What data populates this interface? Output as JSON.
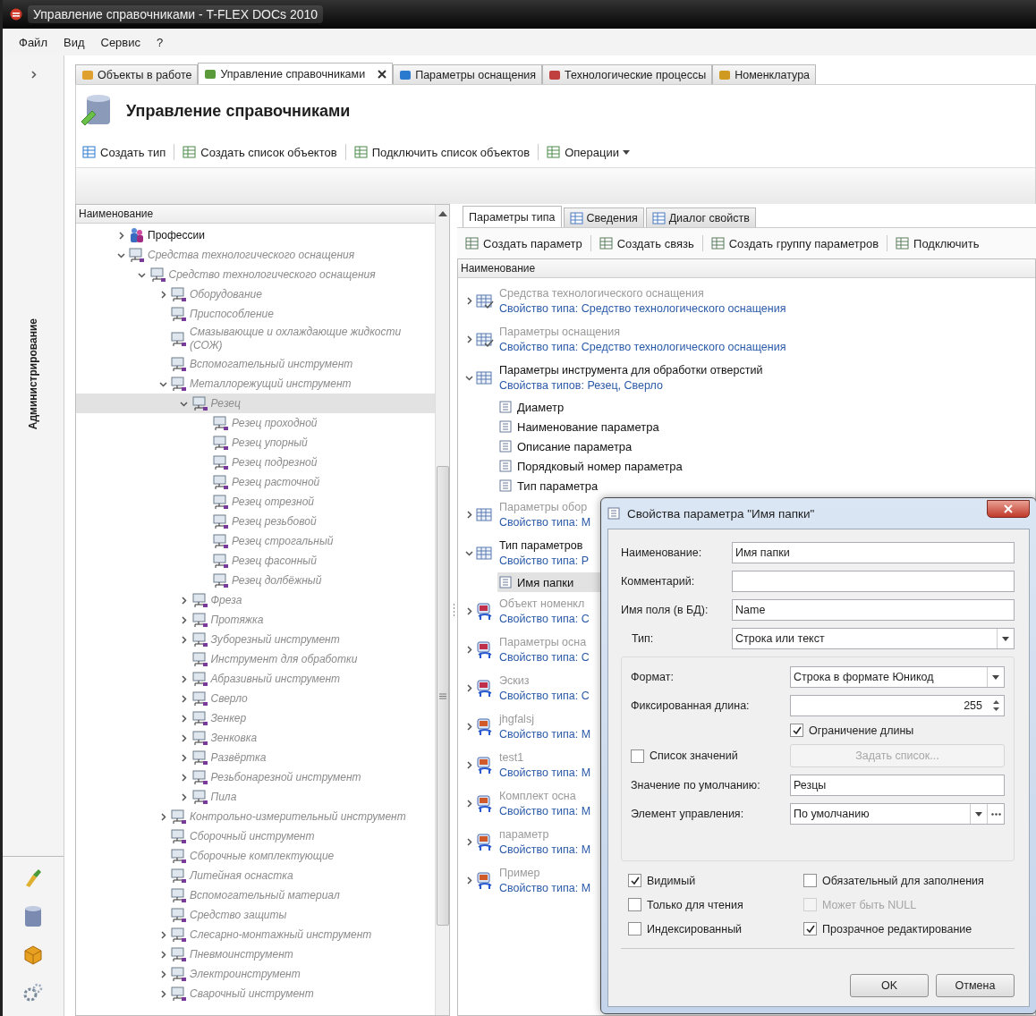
{
  "window": {
    "title": "Управление справочниками - T-FLEX DOCs 2010"
  },
  "menu": [
    "Файл",
    "Вид",
    "Сервис",
    "?"
  ],
  "side_panel": {
    "title": "Администрирование"
  },
  "tabs": [
    {
      "label": "Объекты в работе",
      "selected": false,
      "closable": false
    },
    {
      "label": "Управление справочниками",
      "selected": true,
      "closable": true
    },
    {
      "label": "Параметры оснащения",
      "selected": false,
      "closable": false
    },
    {
      "label": "Технологические процессы",
      "selected": false,
      "closable": false
    },
    {
      "label": "Номенклатура",
      "selected": false,
      "closable": false
    }
  ],
  "page": {
    "title": "Управление справочниками",
    "toolbar": [
      {
        "label": "Создать тип",
        "kind": "button"
      },
      {
        "label": "Создать список объектов",
        "kind": "button"
      },
      {
        "label": "Подключить список объектов",
        "kind": "button"
      },
      {
        "label": "Операции",
        "kind": "menu"
      }
    ]
  },
  "tree": {
    "column": "Наименование",
    "items": [
      {
        "label": "Профессии",
        "kind": "catalog",
        "expanded": false,
        "dimmed": false,
        "selected": false
      },
      {
        "label": "Средства технологического оснащения",
        "kind": "type",
        "expanded": true,
        "dimmed": true,
        "selected": false,
        "children": [
          {
            "label": "Средство технологического оснащения",
            "kind": "type",
            "expanded": true,
            "dimmed": true,
            "selected": false,
            "children": [
              {
                "label": "Оборудование",
                "kind": "type",
                "expanded": false,
                "dimmed": true,
                "selected": false
              },
              {
                "label": "Приспособление",
                "kind": "type",
                "dimmed": true,
                "selected": false
              },
              {
                "label": "Смазывающие и охлаждающие жидкости (СОЖ)",
                "kind": "type",
                "dimmed": true,
                "selected": false
              },
              {
                "label": "Вспомогательный инструмент",
                "kind": "type",
                "dimmed": true,
                "selected": false
              },
              {
                "label": "Металлорежущий инструмент",
                "kind": "type",
                "expanded": true,
                "dimmed": true,
                "selected": false,
                "children": [
                  {
                    "label": "Резец",
                    "kind": "type",
                    "expanded": true,
                    "dimmed": true,
                    "selected": true,
                    "children": [
                      {
                        "label": "Резец проходной",
                        "kind": "type",
                        "dimmed": true,
                        "selected": false
                      },
                      {
                        "label": "Резец упорный",
                        "kind": "type",
                        "dimmed": true,
                        "selected": false
                      },
                      {
                        "label": "Резец подрезной",
                        "kind": "type",
                        "dimmed": true,
                        "selected": false
                      },
                      {
                        "label": "Резец расточной",
                        "kind": "type",
                        "dimmed": true,
                        "selected": false
                      },
                      {
                        "label": "Резец отрезной",
                        "kind": "type",
                        "dimmed": true,
                        "selected": false
                      },
                      {
                        "label": "Резец резьбовой",
                        "kind": "type",
                        "dimmed": true,
                        "selected": false
                      },
                      {
                        "label": "Резец строгальный",
                        "kind": "type",
                        "dimmed": true,
                        "selected": false
                      },
                      {
                        "label": "Резец фасонный",
                        "kind": "type",
                        "dimmed": true,
                        "selected": false
                      },
                      {
                        "label": "Резец долбёжный",
                        "kind": "type",
                        "dimmed": true,
                        "selected": false
                      }
                    ]
                  },
                  {
                    "label": "Фреза",
                    "kind": "type",
                    "expanded": false,
                    "dimmed": true,
                    "selected": false
                  },
                  {
                    "label": "Протяжка",
                    "kind": "type",
                    "expanded": false,
                    "dimmed": true,
                    "selected": false
                  },
                  {
                    "label": "Зуборезный инструмент",
                    "kind": "type",
                    "expanded": false,
                    "dimmed": true,
                    "selected": false
                  },
                  {
                    "label": "Инструмент для обработки",
                    "kind": "type",
                    "dimmed": true,
                    "selected": false
                  },
                  {
                    "label": "Абразивный инструмент",
                    "kind": "type",
                    "expanded": false,
                    "dimmed": true,
                    "selected": false
                  },
                  {
                    "label": "Сверло",
                    "kind": "type",
                    "expanded": false,
                    "dimmed": true,
                    "selected": false
                  },
                  {
                    "label": "Зенкер",
                    "kind": "type",
                    "expanded": false,
                    "dimmed": true,
                    "selected": false
                  },
                  {
                    "label": "Зенковка",
                    "kind": "type",
                    "expanded": false,
                    "dimmed": true,
                    "selected": false
                  },
                  {
                    "label": "Развёртка",
                    "kind": "type",
                    "expanded": false,
                    "dimmed": true,
                    "selected": false
                  },
                  {
                    "label": "Резьбонарезной инструмент",
                    "kind": "type",
                    "expanded": false,
                    "dimmed": true,
                    "selected": false
                  },
                  {
                    "label": "Пила",
                    "kind": "type",
                    "expanded": false,
                    "dimmed": true,
                    "selected": false
                  }
                ]
              },
              {
                "label": "Контрольно-измерительный инструмент",
                "kind": "type",
                "expanded": false,
                "dimmed": true,
                "selected": false
              },
              {
                "label": "Сборочный инструмент",
                "kind": "type",
                "dimmed": true,
                "selected": false
              },
              {
                "label": "Сборочные комплектующие",
                "kind": "type",
                "dimmed": true,
                "selected": false
              },
              {
                "label": "Литейная оснастка",
                "kind": "type",
                "dimmed": true,
                "selected": false
              },
              {
                "label": "Вспомогательный материал",
                "kind": "type",
                "dimmed": true,
                "selected": false
              },
              {
                "label": "Средство защиты",
                "kind": "type",
                "dimmed": true,
                "selected": false
              },
              {
                "label": "Слесарно-монтажный инструмент",
                "kind": "type",
                "expanded": false,
                "dimmed": true,
                "selected": false
              },
              {
                "label": "Пневмоинструмент",
                "kind": "type",
                "expanded": false,
                "dimmed": true,
                "selected": false
              },
              {
                "label": "Электроинструмент",
                "kind": "type",
                "expanded": false,
                "dimmed": true,
                "selected": false
              },
              {
                "label": "Сварочный инструмент",
                "kind": "type",
                "expanded": false,
                "dimmed": true,
                "selected": false
              }
            ]
          }
        ]
      }
    ]
  },
  "right_panel": {
    "tabs": [
      {
        "label": "Параметры типа",
        "selected": true
      },
      {
        "label": "Сведения",
        "selected": false
      },
      {
        "label": "Диалог свойств",
        "selected": false
      }
    ],
    "toolbar": [
      "Создать параметр",
      "Создать связь",
      "Создать группу параметров",
      "Подключить"
    ],
    "column": "Наименование",
    "rows": [
      {
        "kind": "inherited",
        "title": "Средства технологического оснащения",
        "subtitle": "Свойство типа: Средство технологического оснащения",
        "expanded": false,
        "dimmed": true,
        "selected": false
      },
      {
        "kind": "inherited",
        "title": "Параметры оснащения",
        "subtitle": "Свойство типа: Средство технологического оснащения",
        "expanded": false,
        "dimmed": true,
        "selected": false
      },
      {
        "kind": "group",
        "title": "Параметры инструмента для обработки отверстий",
        "subtitle": "Свойства типов: Резец, Сверло",
        "expanded": true,
        "dimmed": false,
        "selected": false
      },
      {
        "kind": "param",
        "title": "Диаметр",
        "dimmed": false,
        "selected": false
      },
      {
        "kind": "param",
        "title": "Наименование параметра",
        "dimmed": false,
        "selected": false
      },
      {
        "kind": "param",
        "title": "Описание параметра",
        "dimmed": false,
        "selected": false
      },
      {
        "kind": "param",
        "title": "Порядковый номер параметра",
        "dimmed": false,
        "selected": false
      },
      {
        "kind": "param",
        "title": "Тип параметра",
        "dimmed": false,
        "selected": false
      },
      {
        "kind": "group",
        "title": "Параметры обор",
        "subtitle": "Свойство типа: М",
        "expanded": false,
        "dimmed": true,
        "selected": false
      },
      {
        "kind": "group",
        "title": "Тип параметров",
        "subtitle": "Свойство типа: Р",
        "expanded": true,
        "dimmed": false,
        "selected": false
      },
      {
        "kind": "param",
        "title": "Имя папки",
        "dimmed": false,
        "selected": true
      },
      {
        "kind": "backlink",
        "title": "Объект номенкл",
        "subtitle": "Свойство типа: С",
        "expanded": false,
        "dimmed": true,
        "selected": false
      },
      {
        "kind": "backlink",
        "title": "Параметры осна",
        "subtitle": "Свойство типа: С",
        "expanded": false,
        "dimmed": true,
        "selected": false
      },
      {
        "kind": "backlink",
        "title": "Эскиз",
        "subtitle": "Свойство типа: С",
        "expanded": false,
        "dimmed": true,
        "selected": false
      },
      {
        "kind": "link",
        "title": "jhgfalsj",
        "subtitle": "Свойство типа: М",
        "expanded": false,
        "dimmed": true,
        "selected": false
      },
      {
        "kind": "link",
        "title": "test1",
        "subtitle": "Свойство типа: М",
        "expanded": false,
        "dimmed": true,
        "selected": false
      },
      {
        "kind": "link",
        "title": "Комплект осна",
        "subtitle": "Свойство типа: М",
        "expanded": false,
        "dimmed": true,
        "selected": false
      },
      {
        "kind": "link",
        "title": "параметр",
        "subtitle": "Свойство типа: М",
        "expanded": false,
        "dimmed": true,
        "selected": false
      },
      {
        "kind": "link",
        "title": "Пример",
        "subtitle": "Свойство типа: М",
        "expanded": false,
        "dimmed": true,
        "selected": false
      }
    ]
  },
  "dialog": {
    "title": "Свойства параметра \"Имя папки\"",
    "fields": [
      {
        "kind": "text",
        "label": "Наименование:",
        "value": "Имя папки"
      },
      {
        "kind": "text",
        "label": "Комментарий:"
      },
      {
        "kind": "text",
        "label": "Имя поля (в БД):",
        "value": "Name"
      },
      {
        "kind": "select",
        "label": "Тип:",
        "value": "Строка или текст"
      }
    ],
    "type_settings": [
      {
        "kind": "select",
        "label": "Формат:",
        "value": "Строка в формате Юникод"
      },
      {
        "kind": "spin",
        "label": "Фиксированная длина:",
        "value": "255"
      },
      {
        "kind": "check",
        "label": "Ограничение длины",
        "checked": true
      },
      {
        "kind": "check_button",
        "label": "Список значений",
        "checked": false,
        "button": "Задать список...",
        "disabled": true
      },
      {
        "kind": "text",
        "label": "Значение по умолчанию:",
        "value": "Резцы"
      },
      {
        "kind": "select_more",
        "label": "Элемент управления:",
        "value": "По умолчанию"
      }
    ],
    "options": [
      {
        "label": "Видимый",
        "checked": true,
        "disabled": false
      },
      {
        "label": "Обязательный для заполнения",
        "checked": false,
        "disabled": false
      },
      {
        "label": "Только для чтения",
        "checked": false,
        "disabled": false
      },
      {
        "label": "Может быть NULL",
        "checked": false,
        "disabled": true
      },
      {
        "label": "Индексированный",
        "checked": false,
        "disabled": false
      },
      {
        "label": "Прозрачное редактирование",
        "checked": true,
        "disabled": false
      }
    ],
    "buttons": [
      "OK",
      "Отмена"
    ]
  }
}
